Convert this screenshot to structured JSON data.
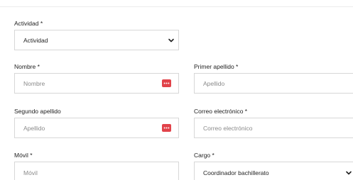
{
  "form": {
    "actividad": {
      "label": "Actividad *",
      "value": "Actividad"
    },
    "nombre": {
      "label": "Nombre *",
      "placeholder": "Nombre"
    },
    "primer_apellido": {
      "label": "Primer apellido *",
      "placeholder": "Apellido"
    },
    "segundo_apellido": {
      "label": "Segundo apellido",
      "placeholder": "Apellido"
    },
    "correo": {
      "label": "Correo electrónico *",
      "placeholder": "Correo electrónico"
    },
    "movil": {
      "label": "Móvil *",
      "placeholder": "Móvil"
    },
    "cargo": {
      "label": "Cargo *",
      "value": "Coordinador bachillerato"
    }
  },
  "icons": {
    "select": "chevron-down-icon",
    "autofill": "password-manager-icon"
  },
  "colors": {
    "autofill_badge": "#e1434a",
    "border": "#d7d7d7",
    "placeholder": "#8a8a8a"
  }
}
